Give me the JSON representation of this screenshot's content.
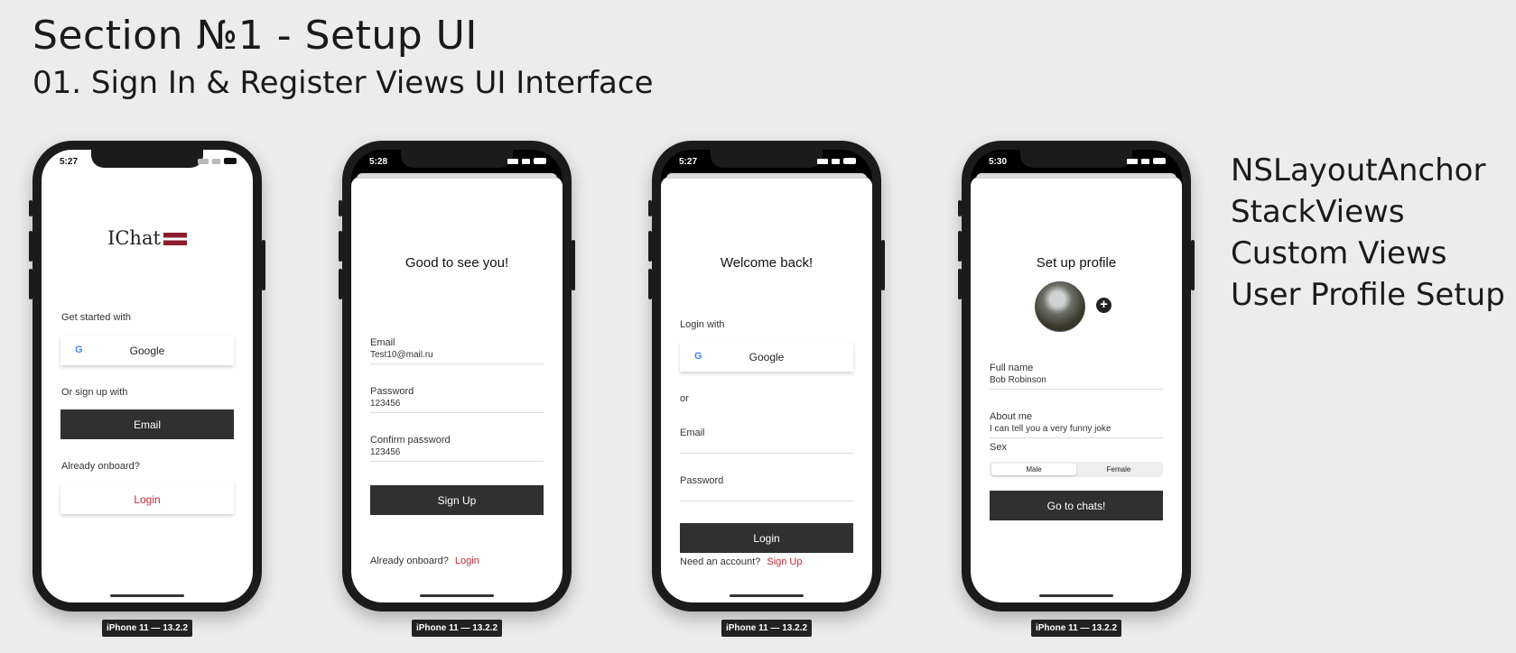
{
  "header": {
    "title": "Section №1 - Setup UI",
    "subtitle": "01. Sign In & Register Views UI Interface"
  },
  "features": [
    "NSLayoutAnchor",
    "StackViews",
    "Custom Views",
    "User Profile Setup"
  ],
  "device_label": "iPhone 11 — 13.2.2",
  "colors": {
    "accent_red": "#c4273a",
    "dark_button": "#303030",
    "background": "#ececec"
  },
  "screen1": {
    "time": "5:27",
    "logo_text": "IChat",
    "get_started": "Get started with",
    "google_label": "Google",
    "or_sign_up": "Or sign up with",
    "email_button": "Email",
    "already_onboard": "Already onboard?",
    "login_button": "Login"
  },
  "screen2": {
    "time": "5:28",
    "title": "Good to see you!",
    "email_label": "Email",
    "email_value": "Test10@mail.ru",
    "password_label": "Password",
    "password_value": "123456",
    "confirm_label": "Confirm password",
    "confirm_value": "123456",
    "signup_button": "Sign Up",
    "already_onboard": "Already onboard?",
    "login_link": "Login"
  },
  "screen3": {
    "time": "5:27",
    "title": "Welcome back!",
    "login_with": "Login with",
    "google_label": "Google",
    "or_text": "or",
    "email_label": "Email",
    "password_label": "Password",
    "login_button": "Login",
    "need_account": "Need an account?",
    "signup_link": "Sign Up"
  },
  "screen4": {
    "time": "5:30",
    "title": "Set up profile",
    "fullname_label": "Full name",
    "fullname_value": "Bob Robinson",
    "about_label": "About me",
    "about_value": "I can tell you a very funny joke",
    "sex_label": "Sex",
    "sex_options": [
      "Male",
      "Female"
    ],
    "sex_selected": "Male",
    "chats_button": "Go to chats!"
  }
}
